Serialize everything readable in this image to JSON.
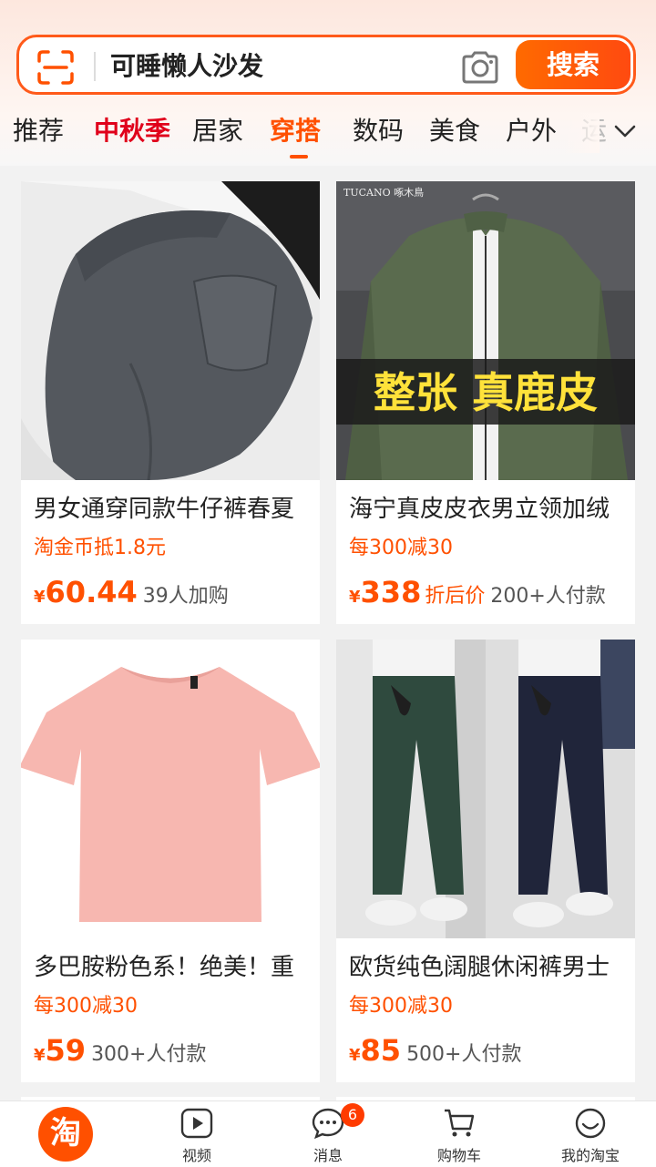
{
  "search": {
    "query": "可睡懒人沙发",
    "button_label": "搜索"
  },
  "tabs": [
    {
      "label": "推荐"
    },
    {
      "label": "中秋季"
    },
    {
      "label": "居家"
    },
    {
      "label": "穿搭"
    },
    {
      "label": "数码"
    },
    {
      "label": "美食"
    },
    {
      "label": "户外"
    },
    {
      "label": "运"
    }
  ],
  "products": [
    {
      "title": "男女通穿同款牛仔裤春夏",
      "promo": "淘金币抵1.8元",
      "yen": "¥",
      "price": "60.44",
      "price_tag": "",
      "sold": "39人加购",
      "image": "gray-jeans-photo"
    },
    {
      "title": "海宁真皮皮衣男立领加绒",
      "promo": "每300减30",
      "yen": "¥",
      "price": "338",
      "price_tag": "折后价",
      "sold": "200+人付款",
      "image": "green-leather-jacket-photo",
      "brand": "TUCANO 啄木鳥",
      "overlay_text": "整张 真鹿皮"
    },
    {
      "title": "多巴胺粉色系！绝美！重",
      "promo": "每300减30",
      "yen": "¥",
      "price": "59",
      "price_tag": "",
      "sold": "300+人付款",
      "image": "pink-tshirt-photo"
    },
    {
      "title": "欧货纯色阔腿休闲裤男士",
      "promo": "每300减30",
      "yen": "¥",
      "price": "85",
      "price_tag": "",
      "sold": "500+人付款",
      "image": "wide-leg-pants-photo"
    }
  ],
  "bottom_nav": {
    "home_icon_text": "淘",
    "items": [
      {
        "label": "视频",
        "icon": "play-icon"
      },
      {
        "label": "消息",
        "icon": "chat-icon"
      },
      {
        "label": "购物车",
        "icon": "cart-icon"
      },
      {
        "label": "我的淘宝",
        "icon": "smile-icon"
      }
    ],
    "message_badge": "6"
  },
  "colors": {
    "accent": "#ff5000",
    "festival_tab": "#e0001b"
  }
}
